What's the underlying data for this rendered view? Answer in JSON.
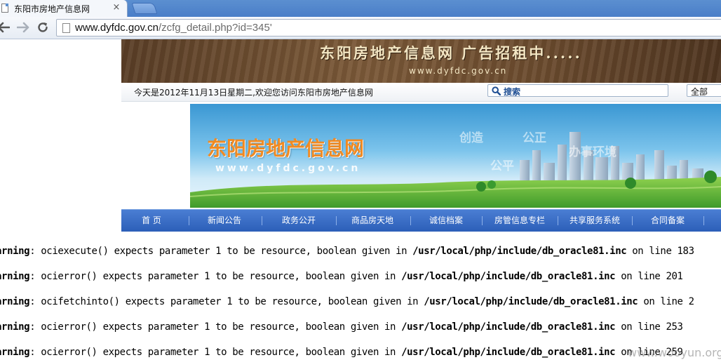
{
  "browser": {
    "tab_title": "东阳市房地产信息网",
    "tab_close": "×",
    "url_host": "www.dyfdc.gov.cn",
    "url_path": "/zcfg_detail.php?id=345'"
  },
  "ad_banner": {
    "title": "东阳房地产信息网  广告招租中.....",
    "url": "www.dyfdc.gov.cn"
  },
  "infobar": {
    "date_text": "今天是2012年11月13日星期二,欢迎您访问东阳市房地产信息网",
    "search_label": "搜索",
    "scope_value": "全部"
  },
  "hero": {
    "title": "东阳房地产信息网",
    "url": "www.dyfdc.gov.cn",
    "words": [
      "创造",
      "公正",
      "公平",
      "办事环境"
    ]
  },
  "nav": {
    "items": [
      "首 页",
      "新闻公告",
      "政务公开",
      "商品房天地",
      "诚信档案",
      "房管信息专栏",
      "共享服务系统",
      "合同备案"
    ]
  },
  "warnings": [
    {
      "label": "Warning",
      "text": ": ociexecute() expects parameter 1 to be resource, boolean given in ",
      "path": "/usr/local/php/include/db_oracle81.inc",
      "suffix": " on line 183"
    },
    {
      "label": "Warning",
      "text": ": ocierror() expects parameter 1 to be resource, boolean given in ",
      "path": "/usr/local/php/include/db_oracle81.inc",
      "suffix": " on line 201"
    },
    {
      "label": "Warning",
      "text": ": ocifetchinto() expects parameter 1 to be resource, boolean given in ",
      "path": "/usr/local/php/include/db_oracle81.inc",
      "suffix": " on line 2"
    },
    {
      "label": "Warning",
      "text": ": ocierror() expects parameter 1 to be resource, boolean given in ",
      "path": "/usr/local/php/include/db_oracle81.inc",
      "suffix": " on line 253"
    },
    {
      "label": "Warning",
      "text": ": ocierror() expects parameter 1 to be resource, boolean given in ",
      "path": "/usr/local/php/include/db_oracle81.inc",
      "suffix": " on line 259"
    }
  ],
  "watermark": "www.wooyun.org",
  "colors": {
    "nav_blue": "#2c5fb8",
    "hero_orange": "#f08a22",
    "ad_brown": "#6b4b2e"
  }
}
